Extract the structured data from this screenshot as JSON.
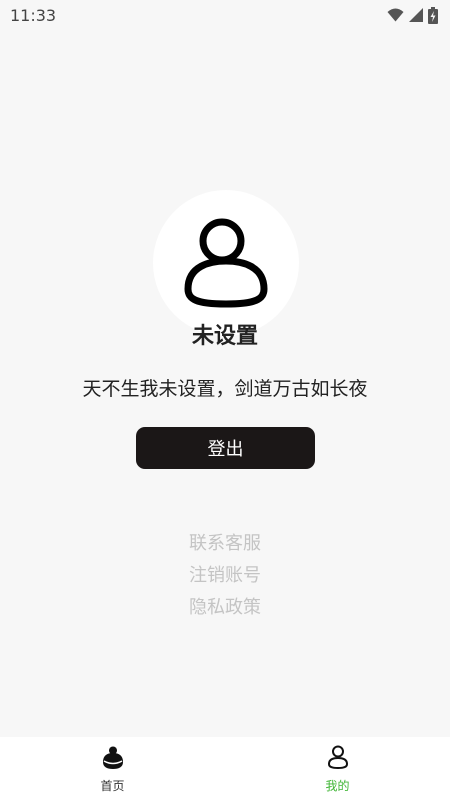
{
  "status_bar": {
    "time": "11:33",
    "icons": [
      "wifi-icon",
      "signal-icon",
      "battery-charging-icon"
    ]
  },
  "profile": {
    "nickname": "未设置",
    "motto": "天不生我未设置，剑道万古如长夜"
  },
  "logout_button": {
    "label": "登出"
  },
  "links": [
    {
      "label": "联系客服"
    },
    {
      "label": "注销账号"
    },
    {
      "label": "隐私政策"
    }
  ],
  "tab_bar": {
    "active_color": "#3fb535",
    "tabs": [
      {
        "label": "首页",
        "icon": "home-icon",
        "active": false
      },
      {
        "label": "我的",
        "icon": "person-icon",
        "active": true
      }
    ]
  }
}
